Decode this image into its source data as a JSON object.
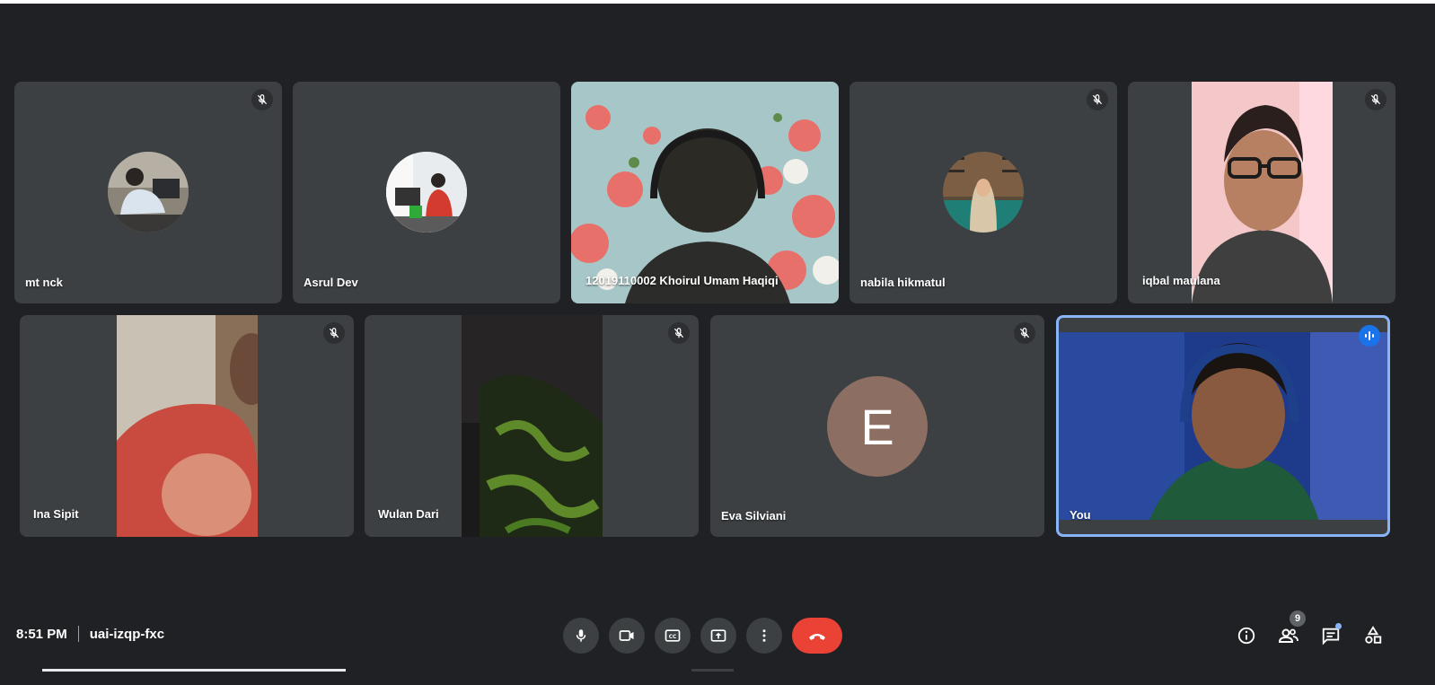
{
  "participants": [
    {
      "name": "mt nck",
      "muted": true,
      "display": "photo-avatar"
    },
    {
      "name": "Asrul Dev",
      "muted": false,
      "display": "photo-avatar"
    },
    {
      "name": "12019110002 Khoirul Umam Haqiqi",
      "muted": false,
      "display": "video"
    },
    {
      "name": "nabila hikmatul",
      "muted": true,
      "display": "photo-avatar"
    },
    {
      "name": "iqbal maulana",
      "muted": true,
      "display": "video"
    },
    {
      "name": "Ina Sipit",
      "muted": true,
      "display": "video"
    },
    {
      "name": "Wulan Dari",
      "muted": true,
      "display": "video"
    },
    {
      "name": "Eva Silviani",
      "muted": true,
      "display": "letter-avatar",
      "initial": "E",
      "avatar_color": "#8d6e63"
    },
    {
      "name": "You",
      "muted": false,
      "speaking": true,
      "display": "video"
    }
  ],
  "meeting": {
    "time": "8:51 PM",
    "code": "uai-izqp-fxc"
  },
  "controls": [
    "microphone",
    "camera",
    "captions",
    "present-screen",
    "more-options",
    "leave-call"
  ],
  "side_controls": [
    "meeting-details",
    "people",
    "chat",
    "activities"
  ],
  "people_count": "9",
  "colors": {
    "background": "#202124",
    "tile": "#3c4043",
    "hangup": "#ea4335",
    "active_speaker": "#1a73e8"
  }
}
